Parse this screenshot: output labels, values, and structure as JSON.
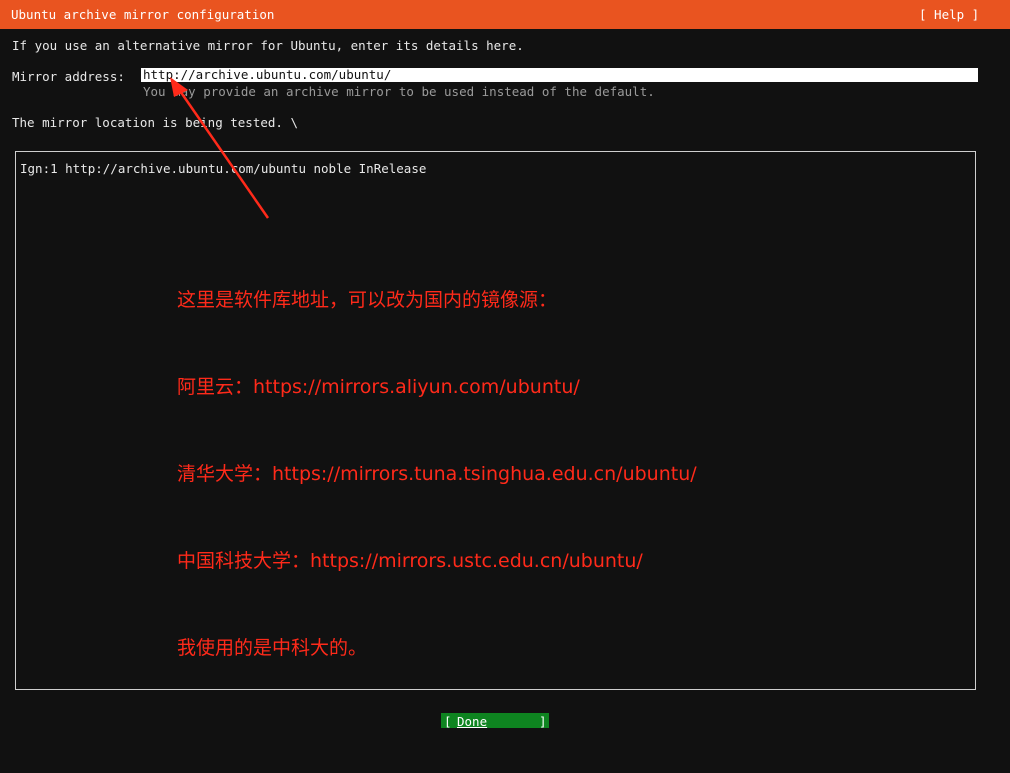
{
  "header": {
    "title": "Ubuntu archive mirror configuration",
    "help_label": "[ Help ]",
    "bar_color": "#e95420"
  },
  "intro_text": "If you use an alternative mirror for Ubuntu, enter its details here.",
  "mirror": {
    "label": "Mirror address:",
    "value": "http://archive.ubuntu.com/ubuntu/",
    "hint": "You may provide an archive mirror to be used instead of the default."
  },
  "status_text": "The mirror location is being tested. \\",
  "log": {
    "lines": [
      "Ign:1 http://archive.ubuntu.com/ubuntu noble InRelease"
    ]
  },
  "annotation": {
    "color": "#ff2a1a",
    "lines": [
      "这里是软件库地址，可以改为国内的镜像源：",
      "阿里云：https://mirrors.aliyun.com/ubuntu/",
      "清华大学：https://mirrors.tuna.tsinghua.edu.cn/ubuntu/",
      "中国科技大学：https://mirrors.ustc.edu.cn/ubuntu/",
      "我使用的是中科大的。"
    ]
  },
  "footer": {
    "done_open": "[",
    "done_label": "Done",
    "done_close": "]",
    "done_color": "#0e8420"
  }
}
